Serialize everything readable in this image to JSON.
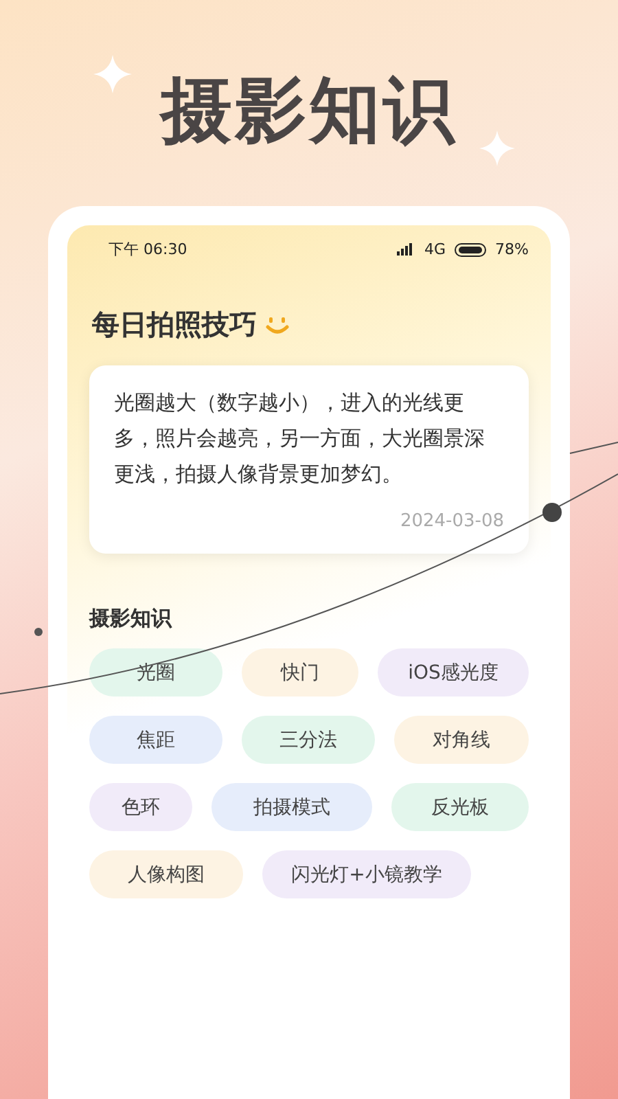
{
  "headline": "摄影知识",
  "status_bar": {
    "time": "下午 06:30",
    "network": "4G",
    "battery": "78%"
  },
  "tip": {
    "title": "每日拍照技巧",
    "text": "光圈越大（数字越小），进入的光线更多，照片会越亮，另一方面，大光圈景深更浅，拍摄人像背景更加梦幻。",
    "date": "2024-03-08"
  },
  "knowledge": {
    "title": "摄影知识",
    "rows": [
      [
        {
          "label": "光圈",
          "color": "#e3f6ec"
        },
        {
          "label": "快门",
          "color": "#fdf3e3"
        },
        {
          "label": "iOS感光度",
          "color": "#f1ebf9"
        }
      ],
      [
        {
          "label": "焦距",
          "color": "#e6edfb"
        },
        {
          "label": "三分法",
          "color": "#e3f6ec"
        },
        {
          "label": "对角线",
          "color": "#fdf3e3"
        }
      ],
      [
        {
          "label": "色环",
          "color": "#f1ebf9"
        },
        {
          "label": "拍摄模式",
          "color": "#e6edfb"
        },
        {
          "label": "反光板",
          "color": "#e3f6ec"
        }
      ],
      [
        {
          "label": "人像构图",
          "color": "#fdf3e3"
        },
        {
          "label": "闪光灯+小镜教学",
          "color": "#f1ebf9"
        }
      ]
    ]
  }
}
